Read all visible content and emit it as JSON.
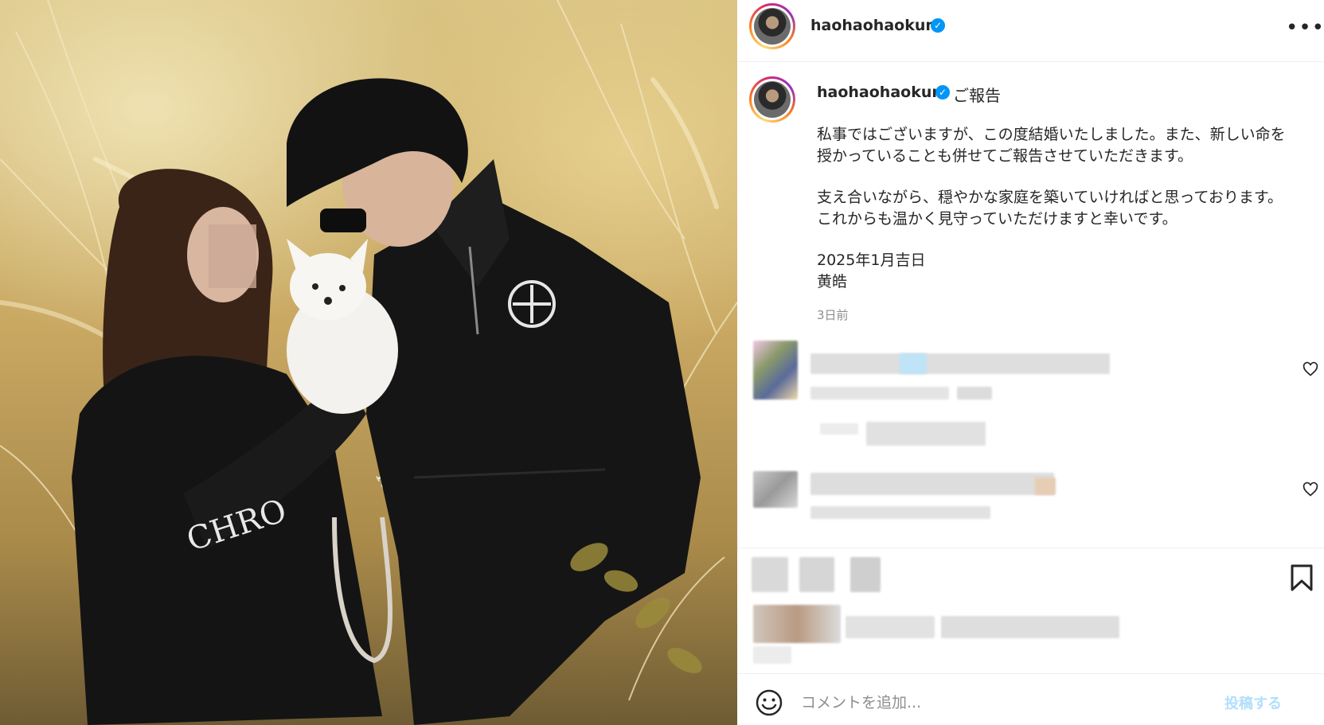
{
  "post": {
    "username": "haohaohaokun",
    "verified_mark": "✓",
    "more_icon": "more-horizontal-icon"
  },
  "caption": {
    "username": "haohaohaokun",
    "title": "ご報告",
    "paragraph1": "私事ではございますが、この度結婚いたしました。また、新しい命を授かっていることも併せてご報告させていただきます。",
    "paragraph2": "支え合いながら、穏やかな家庭を築いていければと思っております。これからも温かく見守っていただけますと幸いです。",
    "date_line": "2025年1月吉日",
    "signature": "黄皓",
    "time_ago": "3日前"
  },
  "actions": {
    "bookmark_icon": "bookmark-icon",
    "heart_icon": "heart-icon"
  },
  "composer": {
    "emoji_icon": "smiley-icon",
    "placeholder": "コメントを追加...",
    "post_label": "投稿する"
  },
  "colors": {
    "verified_blue": "#0095f6",
    "post_button_disabled": "#b2dffc",
    "muted_text": "#8e8e8e"
  }
}
